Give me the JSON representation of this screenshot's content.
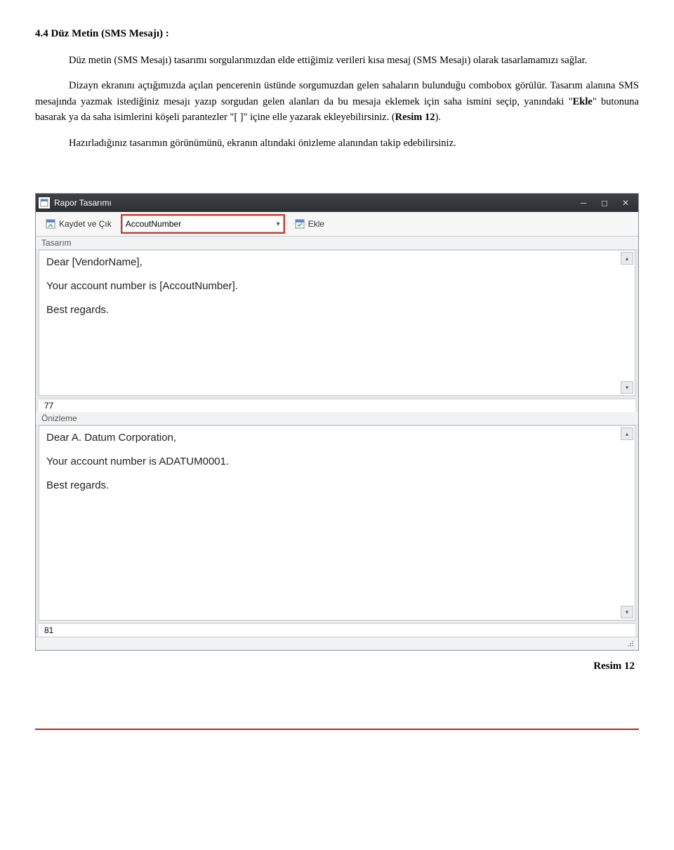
{
  "doc": {
    "heading": "4.4 Düz Metin (SMS Mesajı) :",
    "p1": "Düz metin (SMS Mesajı) tasarımı sorgularımızdan elde ettiğimiz verileri kısa mesaj (SMS Mesajı) olarak tasarlamamızı sağlar.",
    "p2": "Dizayn ekranını açtığımızda açılan pencerenin üstünde sorgumuzdan gelen sahaların bulunduğu  combobox görülür. Tasarım alanına SMS mesajında yazmak istediğiniz mesajı yazıp sorgudan gelen alanları da bu mesaja eklemek için saha ismini seçip, yanındaki \"",
    "p2_bold": "Ekle",
    "p2_tail": "\" butonuna basarak ya da saha isimlerini köşeli parantezler \"[   ]\" içine elle yazarak ekleyebilirsiniz. (",
    "p2_bold2": "Resim 12",
    "p2_end": ").",
    "p3": "Hazırladığınız tasarımın görünümünü, ekranın altındaki önizleme alanından takip edebilirsiniz.",
    "caption": "Resim 12"
  },
  "window": {
    "title": "Rapor Tasarımı",
    "toolbar": {
      "save_exit": "Kaydet ve Çık",
      "field_selected": "AccoutNumber",
      "add": "Ekle"
    },
    "design_label": "Tasarım",
    "design_text": "Dear [VendorName],\n\nYour account number is [AccoutNumber].\n\nBest regards.",
    "design_count": "77",
    "preview_label": "Önizleme",
    "preview_text": "Dear A. Datum Corporation,\n\nYour account number is ADATUM0001.\n\nBest regards.",
    "preview_count": "81"
  }
}
